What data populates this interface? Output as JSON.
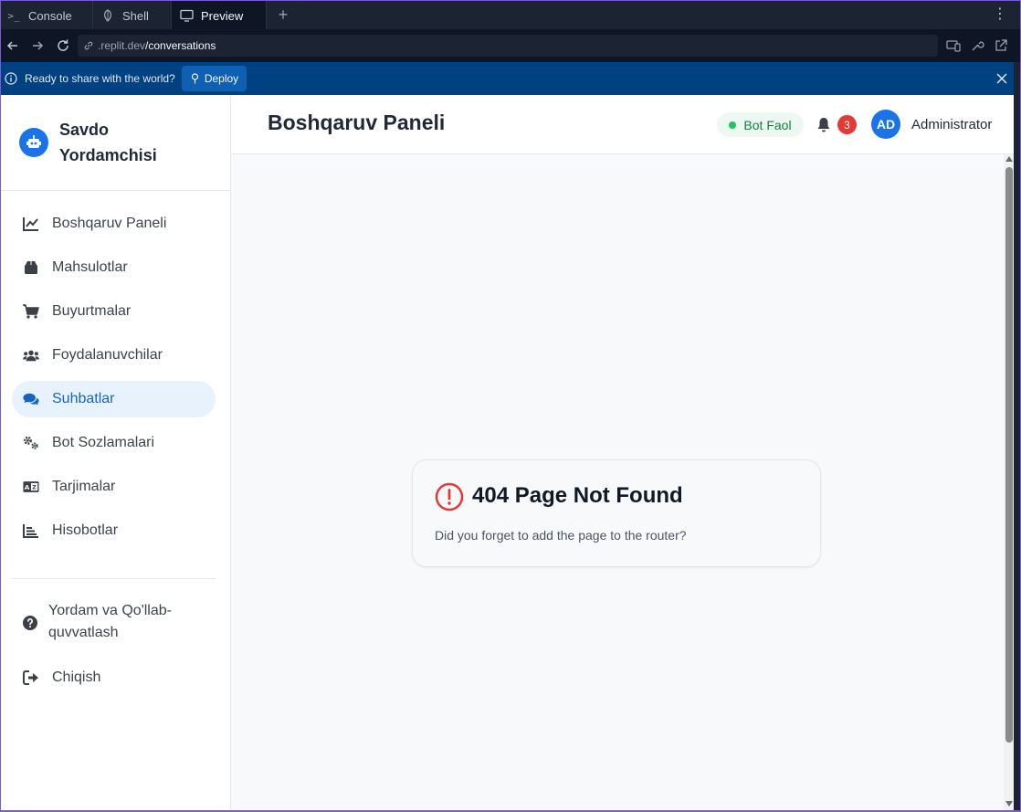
{
  "ide": {
    "tabs": [
      {
        "label": "Console",
        "icon": "terminal-icon"
      },
      {
        "label": "Shell",
        "icon": "shell-icon"
      },
      {
        "label": "Preview",
        "icon": "monitor-icon",
        "active": true
      }
    ],
    "url_host": ".replit.dev",
    "url_path": "/conversations",
    "banner_text": "Ready to share with the world?",
    "deploy_label": "Deploy"
  },
  "sidebar": {
    "brand_line1": "Savdo",
    "brand_line2": "Yordamchisi",
    "items": [
      {
        "label": "Boshqaruv Paneli",
        "icon": "chart-line-icon"
      },
      {
        "label": "Mahsulotlar",
        "icon": "box-icon"
      },
      {
        "label": "Buyurtmalar",
        "icon": "cart-icon"
      },
      {
        "label": "Foydalanuvchilar",
        "icon": "users-icon"
      },
      {
        "label": "Suhbatlar",
        "icon": "chat-icon",
        "active": true
      },
      {
        "label": "Bot Sozlamalari",
        "icon": "gears-icon"
      },
      {
        "label": "Tarjimalar",
        "icon": "translate-icon"
      },
      {
        "label": "Hisobotlar",
        "icon": "bar-chart-icon"
      }
    ],
    "help_label": "Yordam va Qo'llab-quvvatlash",
    "logout_label": "Chiqish"
  },
  "header": {
    "title": "Boshqaruv Paneli",
    "status": "Bot Faol",
    "notification_count": "3",
    "avatar_initials": "AD",
    "user_name": "Administrator"
  },
  "error": {
    "title": "404 Page Not Found",
    "message": "Did you forget to add the page to the router?"
  },
  "colors": {
    "primary": "#1a73e8",
    "active_bg": "#e8f2fd",
    "status_green": "#22c55e",
    "error_red": "#e53935"
  }
}
